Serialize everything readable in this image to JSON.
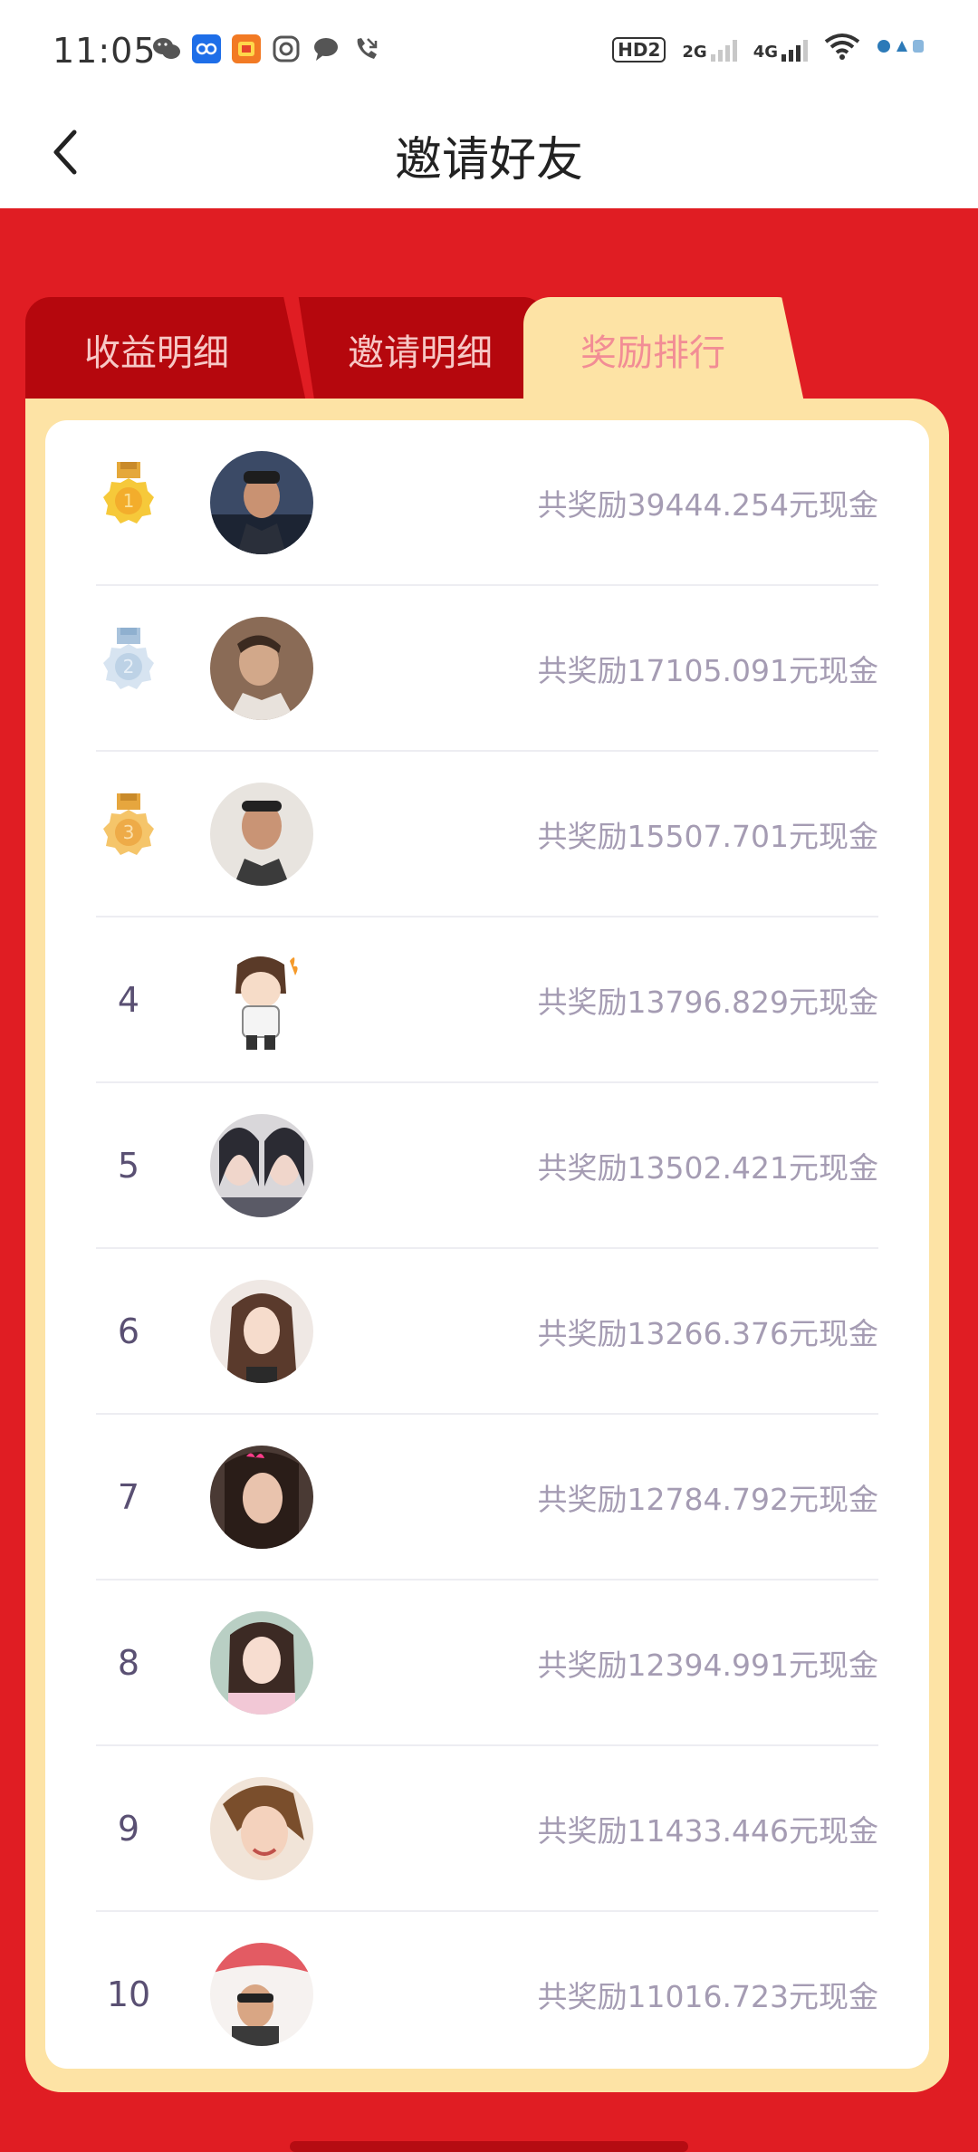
{
  "status_bar": {
    "time": "11:05",
    "hd": "HD2",
    "net1": "2G",
    "net2": "4G",
    "app_icons": [
      "wechat-icon",
      "app-blue-icon",
      "taobao-icon",
      "camera-app-icon",
      "message-icon",
      "missed-call-icon"
    ]
  },
  "header": {
    "title": "邀请好友",
    "back_icon": "chevron-left-icon"
  },
  "tabs": [
    {
      "label": "收益明细",
      "active": false
    },
    {
      "label": "邀请明细",
      "active": false
    },
    {
      "label": "奖励排行",
      "active": true
    }
  ],
  "ranking": [
    {
      "rank": "1",
      "badge": "gold-medal-icon",
      "reward": "共奖励39444.254元现金"
    },
    {
      "rank": "2",
      "badge": "silver-medal-icon",
      "reward": "共奖励17105.091元现金"
    },
    {
      "rank": "3",
      "badge": "bronze-medal-icon",
      "reward": "共奖励15507.701元现金"
    },
    {
      "rank": "4",
      "reward": "共奖励13796.829元现金"
    },
    {
      "rank": "5",
      "reward": "共奖励13502.421元现金"
    },
    {
      "rank": "6",
      "reward": "共奖励13266.376元现金"
    },
    {
      "rank": "7",
      "reward": "共奖励12784.792元现金"
    },
    {
      "rank": "8",
      "reward": "共奖励12394.991元现金"
    },
    {
      "rank": "9",
      "reward": "共奖励11433.446元现金"
    },
    {
      "rank": "10",
      "reward": "共奖励11016.723元现金"
    }
  ],
  "colors": {
    "primary_red": "#e01d23",
    "tab_dark_red": "#b5070d",
    "panel_cream": "#fde3a5",
    "active_tab_text": "#f28d95",
    "reward_text": "#a59cb3",
    "gold": "#f5c43a",
    "silver": "#cbdcec",
    "bronze": "#f2c15e"
  }
}
